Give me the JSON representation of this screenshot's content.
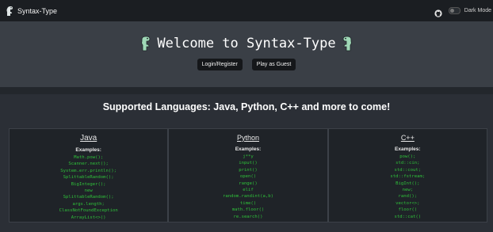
{
  "colors": {
    "code_green": "#2fc03a",
    "navbar": "#1b1e22",
    "hero": "#3a3f46",
    "card": "#1f2328"
  },
  "navbar": {
    "brand": "Syntax-Type",
    "mode_label": "Dark Mode",
    "icons": [
      "dino-logo-icon",
      "github-icon"
    ]
  },
  "hero": {
    "title": "Welcome to Syntax-Type",
    "login_label": "Login/Register",
    "guest_label": "Play as Guest"
  },
  "languages_heading": "Supported Languages: Java, Python, C++ and more to come!",
  "cards": [
    {
      "title": "Java",
      "examples_label": "Examples:",
      "examples": [
        "Math.pow();",
        "Scanner.next();",
        "System.err.println();",
        "SplittableRandom();",
        "BigInteger();",
        "new",
        "SplittableRandom();",
        "args.length;",
        "ClassNotFoundException",
        "ArrayList<>()"
      ]
    },
    {
      "title": "Python",
      "examples_label": "Examples:",
      "examples": [
        "j**y",
        "input()",
        "print()",
        "open()",
        "range()",
        "elif",
        "random.randint(a,b)",
        "time()",
        "math.floor()",
        "re.search()"
      ]
    },
    {
      "title": "C++",
      "examples_label": "Examples:",
      "examples": [
        "pow();",
        "std::cin;",
        "std::cout;",
        "std::fstream;",
        "BigInt();",
        "new;",
        "rand();",
        "vector<>;",
        "floor()",
        "std::cat()"
      ]
    }
  ]
}
